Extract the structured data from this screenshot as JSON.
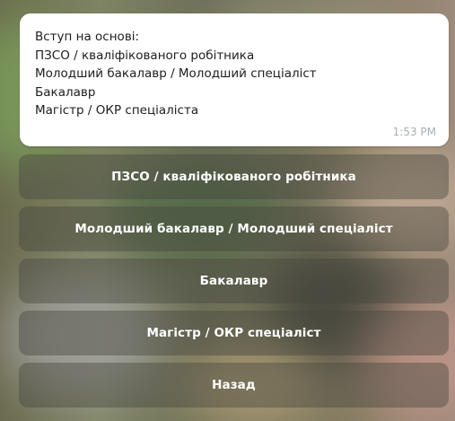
{
  "message": {
    "lines": [
      "Вступ на основі:",
      "ПЗСО / кваліфікованого робітника",
      "Молодший бакалавр / Молодший спеціаліст",
      "Бакалавр",
      "Магістр / ОКР спеціаліста"
    ],
    "time": "1:53 PM"
  },
  "keyboard": {
    "buttons": [
      "ПЗСО /  кваліфікованого робітника",
      "Молодший бакалавр /  Молодший спеціаліст",
      "Бакалавр",
      "Магістр /  ОКР спеціаліст",
      "Назад"
    ]
  },
  "colors": {
    "bubble": "#ffffff",
    "time_text": "#a7b0b8",
    "button_text": "#ffffff"
  }
}
